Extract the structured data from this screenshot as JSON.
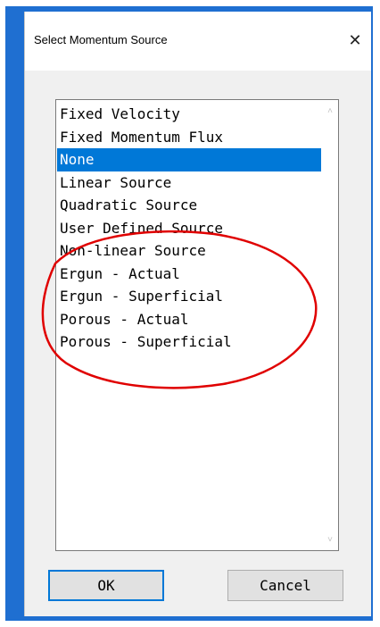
{
  "dialog": {
    "title": "Select Momentum Source",
    "close_glyph": "✕"
  },
  "listbox": {
    "items": [
      {
        "label": "Fixed Velocity",
        "selected": false
      },
      {
        "label": "Fixed Momentum Flux",
        "selected": false
      },
      {
        "label": "None",
        "selected": true
      },
      {
        "label": "Linear Source",
        "selected": false
      },
      {
        "label": "Quadratic Source",
        "selected": false
      },
      {
        "label": "User Defined Source",
        "selected": false
      },
      {
        "label": "Non-linear Source",
        "selected": false
      },
      {
        "label": "Ergun - Actual",
        "selected": false
      },
      {
        "label": "Ergun - Superficial",
        "selected": false
      },
      {
        "label": "Porous - Actual",
        "selected": false
      },
      {
        "label": "Porous - Superficial",
        "selected": false
      }
    ],
    "scroll_up_glyph": "˄",
    "scroll_down_glyph": "˅"
  },
  "buttons": {
    "ok_label": "OK",
    "cancel_label": "Cancel"
  },
  "colors": {
    "frame_blue": "#1f6fd1",
    "selection_blue": "#0078d7",
    "annotation_red": "#e00000"
  },
  "icons": {
    "close": "close-icon",
    "scroll_up": "chevron-up-icon",
    "scroll_down": "chevron-down-icon"
  }
}
